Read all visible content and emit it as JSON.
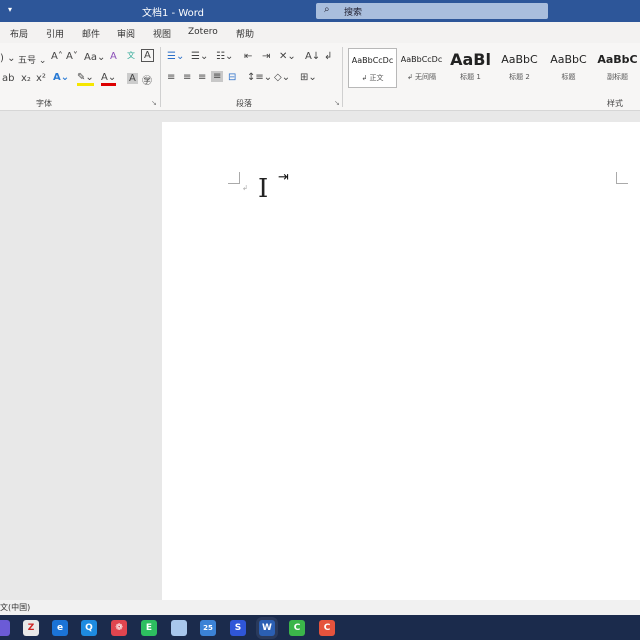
{
  "window": {
    "title": "文档1  -  Word",
    "quick_access": "▾"
  },
  "search": {
    "placeholder": "搜索",
    "icon": "search-icon"
  },
  "tabs": [
    "布局",
    "引用",
    "邮件",
    "审阅",
    "视图",
    "Zotero",
    "帮助"
  ],
  "font": {
    "size": "五号",
    "group_label": "字体"
  },
  "paragraph": {
    "group_label": "段落"
  },
  "styles": {
    "group_label": "样式",
    "items": [
      {
        "preview": "AaBbCcDc",
        "label": "↲ 正文"
      },
      {
        "preview": "AaBbCcDc",
        "label": "↲ 无间隔"
      },
      {
        "preview": "AaBl",
        "label": "标题 1"
      },
      {
        "preview": "AaBbC",
        "label": "标题 2"
      },
      {
        "preview": "AaBbC",
        "label": "标题"
      },
      {
        "preview": "AaBbC",
        "label": "副标题"
      }
    ]
  },
  "status": {
    "language": "文(中国)"
  },
  "taskbar": {
    "apps": [
      {
        "name": "zotero",
        "glyph": "Z",
        "color": "#e8e8e8"
      },
      {
        "name": "edge",
        "glyph": "e",
        "color": "#1b73d6"
      },
      {
        "name": "qq-browser",
        "glyph": "Q",
        "color": "#1e8be0"
      },
      {
        "name": "netease-music",
        "glyph": "❁",
        "color": "#e0454f"
      },
      {
        "name": "evernote",
        "glyph": "E",
        "color": "#2dbe60"
      },
      {
        "name": "notebook",
        "glyph": "",
        "color": "#a8c7ec"
      },
      {
        "name": "calendar",
        "glyph": "25",
        "color": "#3b82d6"
      },
      {
        "name": "baidu-netdisk",
        "glyph": "S",
        "color": "#2f56d8"
      },
      {
        "name": "word",
        "glyph": "W",
        "color": "#2b5fb3"
      },
      {
        "name": "camtasia-green",
        "glyph": "C",
        "color": "#3bb54a"
      },
      {
        "name": "camtasia-red",
        "glyph": "C",
        "color": "#e5533d"
      }
    ]
  }
}
